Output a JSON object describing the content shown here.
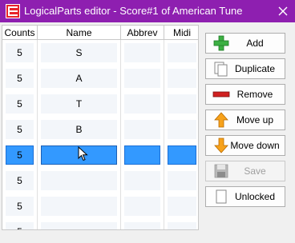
{
  "window": {
    "title": "LogicalParts editor - Score#1 of American Tune"
  },
  "grid": {
    "columns": [
      "Counts",
      "Name",
      "Abbrev",
      "Midi"
    ],
    "rows": [
      {
        "counts": "5",
        "name": "S",
        "abbrev": "",
        "midi": "",
        "selected": false
      },
      {
        "counts": "5",
        "name": "A",
        "abbrev": "",
        "midi": "",
        "selected": false
      },
      {
        "counts": "5",
        "name": "T",
        "abbrev": "",
        "midi": "",
        "selected": false
      },
      {
        "counts": "5",
        "name": "B",
        "abbrev": "",
        "midi": "",
        "selected": false
      },
      {
        "counts": "5",
        "name": "",
        "abbrev": "",
        "midi": "",
        "selected": true
      },
      {
        "counts": "5",
        "name": "",
        "abbrev": "",
        "midi": "",
        "selected": false
      },
      {
        "counts": "5",
        "name": "",
        "abbrev": "",
        "midi": "",
        "selected": false
      },
      {
        "counts": "5",
        "name": "",
        "abbrev": "",
        "midi": "",
        "selected": false
      }
    ]
  },
  "buttons": {
    "add": "Add",
    "duplicate": "Duplicate",
    "remove": "Remove",
    "move_up": "Move up",
    "move_down": "Move down",
    "save": "Save",
    "unlocked": "Unlocked"
  },
  "colors": {
    "titlebar": "#8e1fb0",
    "selection": "#3399ff"
  }
}
